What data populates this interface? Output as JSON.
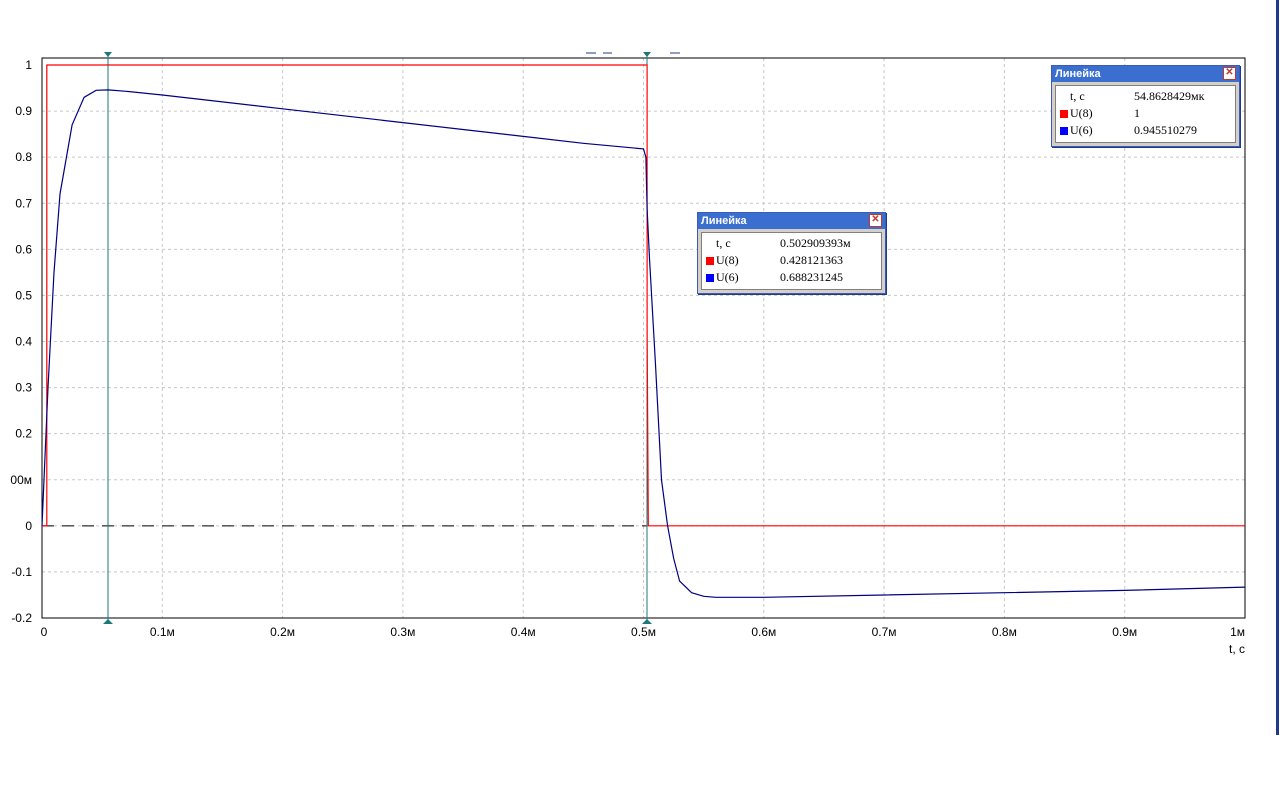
{
  "chart_data": {
    "type": "line",
    "xlabel": "t, c",
    "x_range": [
      0,
      0.001
    ],
    "y_range": [
      -0.2,
      1.0
    ],
    "x_ticks": [
      {
        "v": 0,
        "label": "0"
      },
      {
        "v": 0.0001,
        "label": "0.1м"
      },
      {
        "v": 0.0002,
        "label": "0.2м"
      },
      {
        "v": 0.0003,
        "label": "0.3м"
      },
      {
        "v": 0.0004,
        "label": "0.4м"
      },
      {
        "v": 0.0005,
        "label": "0.5м"
      },
      {
        "v": 0.0006,
        "label": "0.6м"
      },
      {
        "v": 0.0007,
        "label": "0.7м"
      },
      {
        "v": 0.0008,
        "label": "0.8м"
      },
      {
        "v": 0.0009,
        "label": "0.9м"
      },
      {
        "v": 0.001,
        "label": "1м"
      }
    ],
    "y_ticks": [
      {
        "v": 1.0,
        "label": "1"
      },
      {
        "v": 0.9,
        "label": "0.9"
      },
      {
        "v": 0.8,
        "label": "0.8"
      },
      {
        "v": 0.7,
        "label": "0.7"
      },
      {
        "v": 0.6,
        "label": "0.6"
      },
      {
        "v": 0.5,
        "label": "0.5"
      },
      {
        "v": 0.4,
        "label": "0.4"
      },
      {
        "v": 0.3,
        "label": "0.3"
      },
      {
        "v": 0.2,
        "label": "0.2"
      },
      {
        "v": 0.1,
        "label": "00м"
      },
      {
        "v": 0.0,
        "label": "0"
      },
      {
        "v": -0.1,
        "label": "-0.1"
      },
      {
        "v": -0.2,
        "label": "-0.2"
      }
    ],
    "grid": true,
    "series": [
      {
        "name": "U(8)",
        "color": "#ff0000",
        "x": [
          0,
          4e-06,
          4e-06,
          0.000503,
          0.000503,
          0.000504,
          0.001
        ],
        "y": [
          0,
          0,
          1.0,
          1.0,
          0.428,
          0,
          0
        ]
      },
      {
        "name": "U(6)",
        "color": "#000080",
        "x": [
          0,
          5e-06,
          1e-05,
          1.5e-05,
          2.5e-05,
          3.5e-05,
          4.5e-05,
          5.5e-05,
          7e-05,
          0.0001,
          0.00015,
          0.0002,
          0.00025,
          0.0003,
          0.00035,
          0.0004,
          0.00045,
          0.0005,
          0.000502,
          0.000503,
          0.000505,
          0.00051,
          0.000515,
          0.00052,
          0.000525,
          0.00053,
          0.00054,
          0.00055,
          0.00056,
          0.0006,
          0.0007,
          0.0008,
          0.0009,
          0.001
        ],
        "y": [
          0,
          0.3,
          0.55,
          0.72,
          0.87,
          0.93,
          0.945,
          0.946,
          0.943,
          0.935,
          0.92,
          0.905,
          0.89,
          0.875,
          0.86,
          0.845,
          0.83,
          0.818,
          0.8,
          0.688,
          0.58,
          0.35,
          0.1,
          0.0,
          -0.07,
          -0.12,
          -0.145,
          -0.153,
          -0.155,
          -0.155,
          -0.15,
          -0.145,
          -0.14,
          -0.133
        ]
      }
    ],
    "zero_line_dashed": true,
    "cursors": [
      {
        "x": 5.48628429e-05
      },
      {
        "x": 0.000502909393
      }
    ]
  },
  "rulers": [
    {
      "title": "Линейка",
      "rows": [
        {
          "key": "t, c",
          "value": "54.8628429мк",
          "color": ""
        },
        {
          "key": "U(8)",
          "value": "1",
          "color": "#ff0000"
        },
        {
          "key": "U(6)",
          "value": "0.945510279",
          "color": "#0000ff"
        }
      ]
    },
    {
      "title": "Линейка",
      "rows": [
        {
          "key": "t, c",
          "value": "0.502909393м",
          "color": ""
        },
        {
          "key": "U(8)",
          "value": "0.428121363",
          "color": "#ff0000"
        },
        {
          "key": "U(6)",
          "value": "0.688231245",
          "color": "#0000ff"
        }
      ]
    }
  ],
  "icons": {
    "close": "close-icon",
    "cursor_marker": "triangle-marker-icon"
  }
}
